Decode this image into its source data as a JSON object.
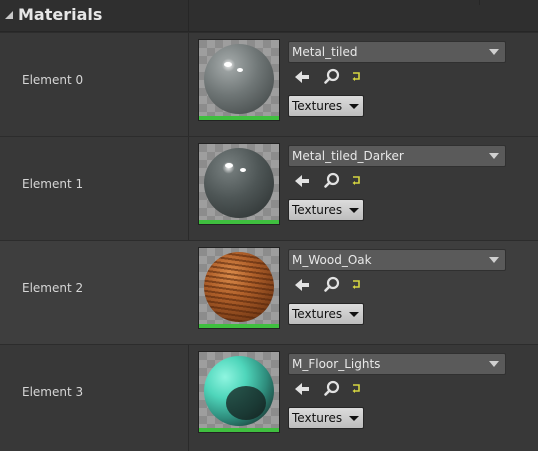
{
  "panel": {
    "title": "Materials",
    "icons": {
      "collapse": "collapse-triangle-icon",
      "use_selected": "left-arrow-icon",
      "browse": "magnifier-icon",
      "reset": "reset-to-default-icon"
    },
    "colors": {
      "background": "#383838",
      "header": "#2f2f2f",
      "thumbnail_bar": "#3fbf3f",
      "reset_icon": "#d6d640"
    }
  },
  "elements": [
    {
      "label": "Element 0",
      "material": "Metal_tiled",
      "textures_label": "Textures"
    },
    {
      "label": "Element 1",
      "material": "Metal_tiled_Darker",
      "textures_label": "Textures"
    },
    {
      "label": "Element 2",
      "material": "M_Wood_Oak",
      "textures_label": "Textures"
    },
    {
      "label": "Element 3",
      "material": "M_Floor_Lights",
      "textures_label": "Textures"
    }
  ]
}
